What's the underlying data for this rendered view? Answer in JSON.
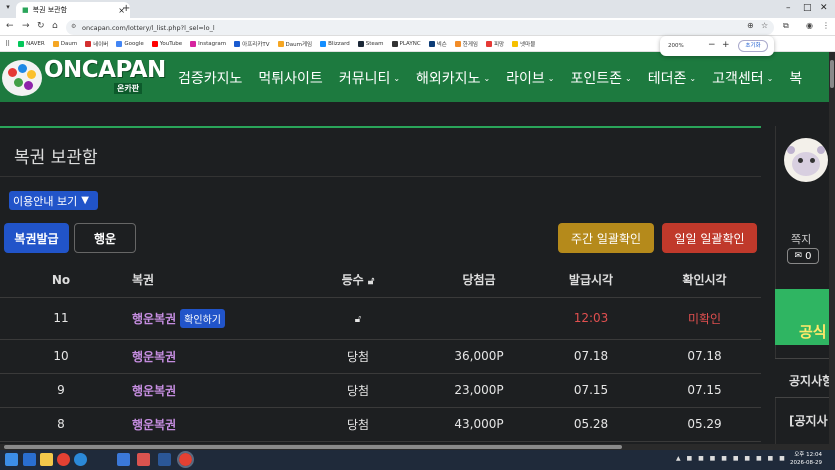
{
  "browser": {
    "tab_title": "복권 보관함",
    "url": "oncapan.com/lottery/l_list.php?l_sel=lo_l",
    "zoom_level": "200%",
    "zoom_reset": "초기화",
    "bookmarks": [
      {
        "label": "NAVER",
        "color": "#03c75a"
      },
      {
        "label": "Daum",
        "color": "#f5a623"
      },
      {
        "label": "네이버",
        "color": "#d32f2f"
      },
      {
        "label": "Google",
        "color": "#4285f4"
      },
      {
        "label": "YouTube",
        "color": "#ff0000"
      },
      {
        "label": "Instagram",
        "color": "#d6249f"
      },
      {
        "label": "아프리카TV",
        "color": "#1a5bd0"
      },
      {
        "label": "Daum게임",
        "color": "#f5a623"
      },
      {
        "label": "Blizzard",
        "color": "#148eff"
      },
      {
        "label": "Steam",
        "color": "#1b2838"
      },
      {
        "label": "PLAYNC",
        "color": "#333333"
      },
      {
        "label": "넥슨",
        "color": "#0d3c76"
      },
      {
        "label": "한게임",
        "color": "#f28c28"
      },
      {
        "label": "피망",
        "color": "#e53935"
      },
      {
        "label": "넷마블",
        "color": "#f6c000"
      }
    ]
  },
  "site": {
    "logo_text": "ONCAPAN",
    "logo_sub": "온카판",
    "menu": [
      {
        "label": "검증카지노",
        "dropdown": false
      },
      {
        "label": "먹튀사이트",
        "dropdown": false
      },
      {
        "label": "커뮤니티",
        "dropdown": true
      },
      {
        "label": "해외카지노",
        "dropdown": true
      },
      {
        "label": "라이브",
        "dropdown": true
      },
      {
        "label": "포인트존",
        "dropdown": true
      },
      {
        "label": "테더존",
        "dropdown": true
      },
      {
        "label": "고객센터",
        "dropdown": true
      },
      {
        "label": "복",
        "dropdown": false
      }
    ]
  },
  "page": {
    "title": "복권 보관함",
    "guide_button": "이용안내 보기",
    "tab_issue": "복권발급",
    "tab_luck": "행운",
    "weekly_button": "주간 일괄확인",
    "daily_button": "일일 일괄확인",
    "columns": [
      "No",
      "복권",
      "등수",
      "당첨금",
      "발급시각",
      "확인시각"
    ],
    "rows": [
      {
        "no": "11",
        "name": "행운복권",
        "confirm": "확인하기",
        "rank": "",
        "prize": "",
        "issued": "12:03",
        "checked": "미확인"
      },
      {
        "no": "10",
        "name": "행운복권",
        "confirm": "",
        "rank": "당첨",
        "prize": "36,000P",
        "issued": "07.18",
        "checked": "07.18"
      },
      {
        "no": "9",
        "name": "행운복권",
        "confirm": "",
        "rank": "당첨",
        "prize": "23,000P",
        "issued": "07.15",
        "checked": "07.15"
      },
      {
        "no": "8",
        "name": "행운복권",
        "confirm": "",
        "rank": "당첨",
        "prize": "43,000P",
        "issued": "05.28",
        "checked": "05.29"
      }
    ]
  },
  "sidebar": {
    "memo_label": "쪽지",
    "memo_count": "0",
    "green_banner": "공식",
    "notice_header": "공지사항",
    "notice_item": "[공지사"
  },
  "taskbar": {
    "time": "오후 12:04",
    "date": "2026-08-29"
  },
  "colors": {
    "nav_green": "#1d7a3f",
    "weekly_gold": "#b58a1b",
    "daily_red": "#c0392b",
    "accent_blue": "#2154c9",
    "lottery_purple": "#c58de0",
    "unchecked_red": "#e04f4f"
  }
}
